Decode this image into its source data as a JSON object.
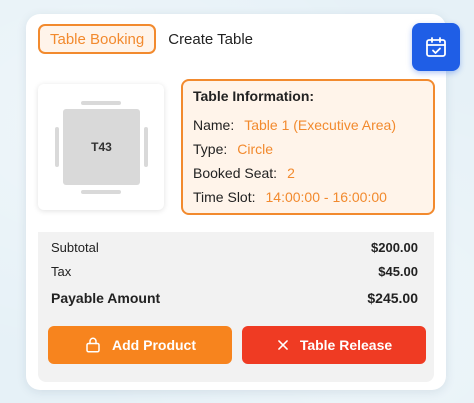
{
  "tabs": [
    {
      "label": "Table Booking"
    },
    {
      "label": "Create Table"
    }
  ],
  "table": {
    "label": "T43"
  },
  "info": {
    "title": "Table Information:",
    "rows": [
      {
        "key": "Name:",
        "value": "Table 1 (Executive Area)"
      },
      {
        "key": "Type:",
        "value": "Circle"
      },
      {
        "key": "Booked Seat:",
        "value": "2"
      },
      {
        "key": "Time Slot:",
        "value": "14:00:00 - 16:00:00"
      }
    ]
  },
  "summary": {
    "subtotal_label": "Subtotal",
    "subtotal_value": "$200.00",
    "tax_label": "Tax",
    "tax_value": "$45.00",
    "payable_label": "Payable Amount",
    "payable_value": "$245.00"
  },
  "actions": {
    "add_label": "Add Product",
    "release_label": "Table Release"
  },
  "icons": {
    "calendar": "calendar-check-icon",
    "lock": "lock-icon",
    "close": "close-icon"
  },
  "colors": {
    "accent": "#f28a2e",
    "primary_blue": "#1f5ee6",
    "add_button": "#f7841e",
    "release_button": "#ef3b23"
  }
}
